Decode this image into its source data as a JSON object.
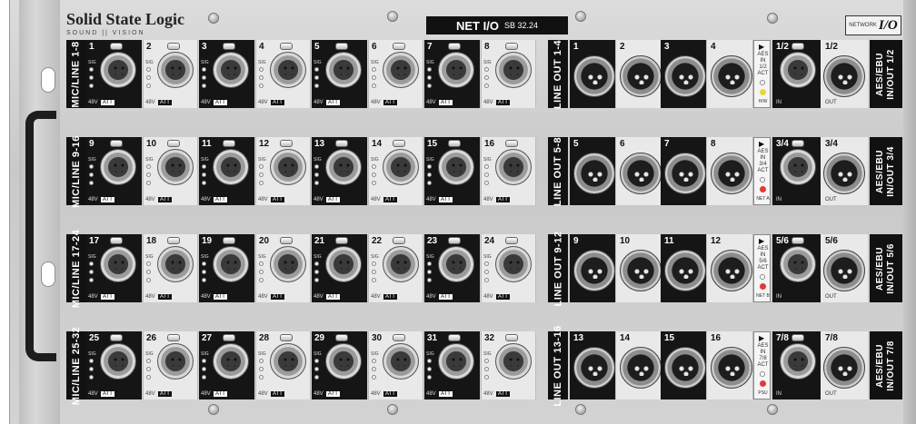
{
  "brand": {
    "name": "Solid State Logic",
    "tagline": "SOUND || VISION"
  },
  "model": {
    "name": "NET I/O",
    "number": "SB 32.24"
  },
  "network_logo": {
    "small_text": "NETWORK",
    "text": "I/O"
  },
  "rows": [
    {
      "mic_label": "MIC/LINE 1-8",
      "mic_channels": [
        "1",
        "2",
        "3",
        "4",
        "5",
        "6",
        "7",
        "8"
      ],
      "out_label": "LINE OUT 1-4",
      "out_channels": [
        "1",
        "2",
        "3",
        "4"
      ],
      "aes_info": "AES\nIN\n1/2\nACT",
      "aes_indicator": "H/W",
      "aes_led_color": "#e8d93a",
      "aes_in_num": "1/2",
      "aes_out_num": "1/2",
      "aes_label": "AES/EBU\nIN/OUT 1/2"
    },
    {
      "mic_label": "MIC/LINE 9-16",
      "mic_channels": [
        "9",
        "10",
        "11",
        "12",
        "13",
        "14",
        "15",
        "16"
      ],
      "out_label": "LINE OUT 5-8",
      "out_channels": [
        "5",
        "6",
        "7",
        "8"
      ],
      "aes_info": "AES\nIN\n3/4\nACT",
      "aes_indicator": "NET A",
      "aes_led_color": "#e23a3a",
      "aes_in_num": "3/4",
      "aes_out_num": "3/4",
      "aes_label": "AES/EBU\nIN/OUT 3/4"
    },
    {
      "mic_label": "MIC/LINE 17-24",
      "mic_channels": [
        "17",
        "18",
        "19",
        "20",
        "21",
        "22",
        "23",
        "24"
      ],
      "out_label": "LINE OUT 9-12",
      "out_channels": [
        "9",
        "10",
        "11",
        "12"
      ],
      "aes_info": "AES\nIN\n5/6\nACT",
      "aes_indicator": "NET B",
      "aes_led_color": "#e23a3a",
      "aes_in_num": "5/6",
      "aes_out_num": "5/6",
      "aes_label": "AES/EBU\nIN/OUT 5/6"
    },
    {
      "mic_label": "MIC/LINE 25-32",
      "mic_channels": [
        "25",
        "26",
        "27",
        "28",
        "29",
        "30",
        "31",
        "32"
      ],
      "out_label": "LINE OUT 13-16",
      "out_channels": [
        "13",
        "14",
        "15",
        "16"
      ],
      "aes_info": "AES\nIN\n7/8\nACT",
      "aes_indicator": "PSU",
      "aes_led_color": "#e23a3a",
      "aes_in_num": "7/8",
      "aes_out_num": "7/8",
      "aes_label": "AES/EBU\nIN/OUT 7/8"
    }
  ],
  "labels": {
    "sig": "SIG",
    "v48": "48V",
    "att": "ATT",
    "in": "IN",
    "out": "OUT",
    "arrow": "▶"
  }
}
